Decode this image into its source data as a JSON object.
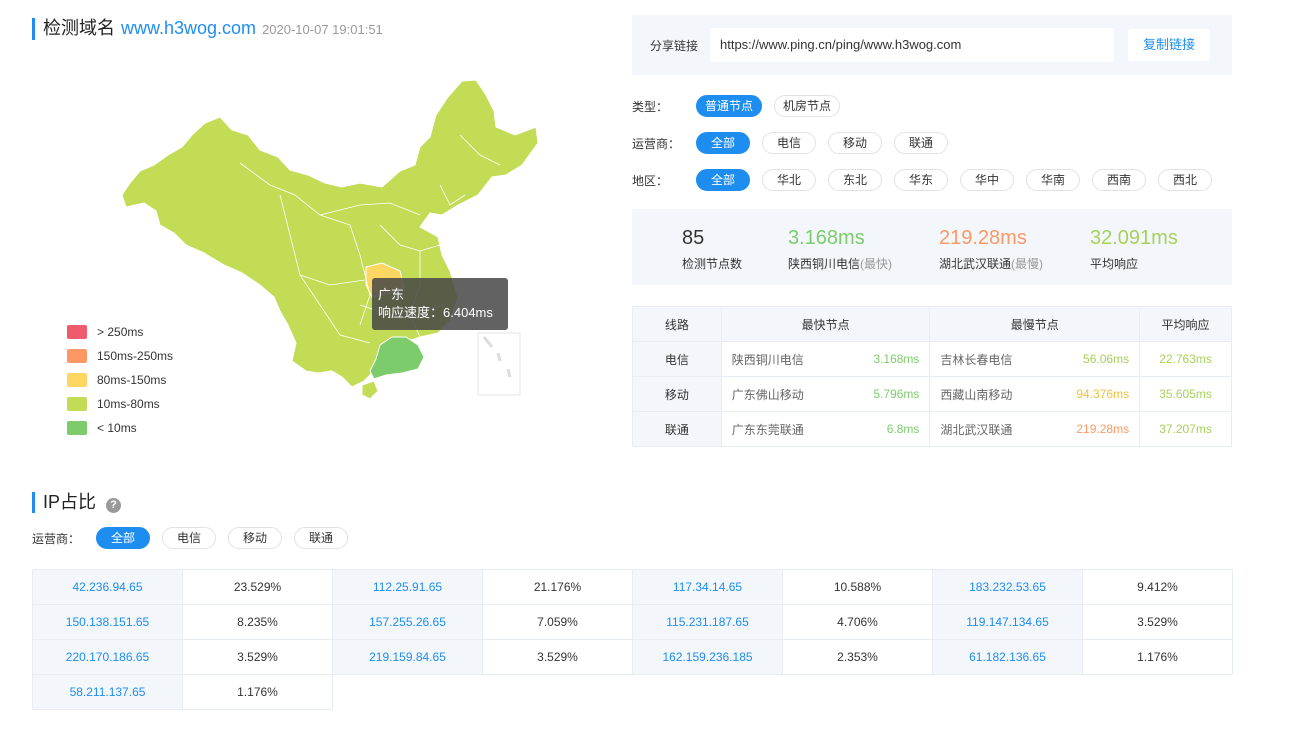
{
  "header": {
    "label": "检测域名",
    "domain": "www.h3wog.com",
    "time": "2020-10-07 19:01:51"
  },
  "map": {
    "tooltip": {
      "region": "广东",
      "speed_label": "响应速度：",
      "speed": "6.404ms"
    },
    "legend": [
      {
        "label": "> 250ms",
        "color": "#ef5b6a"
      },
      {
        "label": "150ms-250ms",
        "color": "#fc9864"
      },
      {
        "label": "80ms-150ms",
        "color": "#fdd762"
      },
      {
        "label": "10ms-80ms",
        "color": "#c2dc55"
      },
      {
        "label": "< 10ms",
        "color": "#7ccc6c"
      }
    ]
  },
  "share": {
    "label": "分享链接",
    "url": "https://www.ping.cn/ping/www.h3wog.com",
    "copy": "复制链接"
  },
  "filters": {
    "type": {
      "label": "类型：",
      "options": [
        "普通节点",
        "机房节点"
      ]
    },
    "isp": {
      "label": "运营商：",
      "options": [
        "全部",
        "电信",
        "移动",
        "联通"
      ]
    },
    "region": {
      "label": "地区：",
      "options": [
        "全部",
        "华北",
        "东北",
        "华东",
        "华中",
        "华南",
        "西南",
        "西北"
      ]
    }
  },
  "stats": {
    "count": {
      "value": "85",
      "label": "检测节点数"
    },
    "fastest": {
      "value": "3.168ms",
      "label": "陕西铜川电信",
      "mark": "(最快)",
      "color": "#7ccc6c"
    },
    "slowest": {
      "value": "219.28ms",
      "label": "湖北武汉联通",
      "mark": "(最慢)",
      "color": "#fc9864"
    },
    "average": {
      "value": "32.091ms",
      "label": "平均响应",
      "color": "#a8d05a"
    }
  },
  "line_table": {
    "headers": [
      "线路",
      "最快节点",
      "最慢节点",
      "平均响应"
    ],
    "rows": [
      {
        "line": "电信",
        "fast_node": "陕西铜川电信",
        "fast_ms": "3.168ms",
        "slow_node": "吉林长春电信",
        "slow_ms": "56.06ms",
        "avg": "22.763ms"
      },
      {
        "line": "移动",
        "fast_node": "广东佛山移动",
        "fast_ms": "5.796ms",
        "slow_node": "西藏山南移动",
        "slow_ms": "94.376ms",
        "avg": "35.605ms"
      },
      {
        "line": "联通",
        "fast_node": "广东东莞联通",
        "fast_ms": "6.8ms",
        "slow_node": "湖北武汉联通",
        "slow_ms": "219.28ms",
        "avg": "37.207ms"
      }
    ]
  },
  "ip_section": {
    "title": "IP占比",
    "help": "?",
    "filter_label": "运营商：",
    "filter_options": [
      "全部",
      "电信",
      "移动",
      "联通"
    ],
    "items": [
      {
        "ip": "42.236.94.65",
        "pct": "23.529%"
      },
      {
        "ip": "112.25.91.65",
        "pct": "21.176%"
      },
      {
        "ip": "117.34.14.65",
        "pct": "10.588%"
      },
      {
        "ip": "183.232.53.65",
        "pct": "9.412%"
      },
      {
        "ip": "150.138.151.65",
        "pct": "8.235%"
      },
      {
        "ip": "157.255.26.65",
        "pct": "7.059%"
      },
      {
        "ip": "115.231.187.65",
        "pct": "4.706%"
      },
      {
        "ip": "119.147.134.65",
        "pct": "3.529%"
      },
      {
        "ip": "220.170.186.65",
        "pct": "3.529%"
      },
      {
        "ip": "219.159.84.65",
        "pct": "3.529%"
      },
      {
        "ip": "162.159.236.185",
        "pct": "2.353%"
      },
      {
        "ip": "61.182.136.65",
        "pct": "1.176%"
      },
      {
        "ip": "58.211.137.65",
        "pct": "1.176%"
      }
    ]
  }
}
